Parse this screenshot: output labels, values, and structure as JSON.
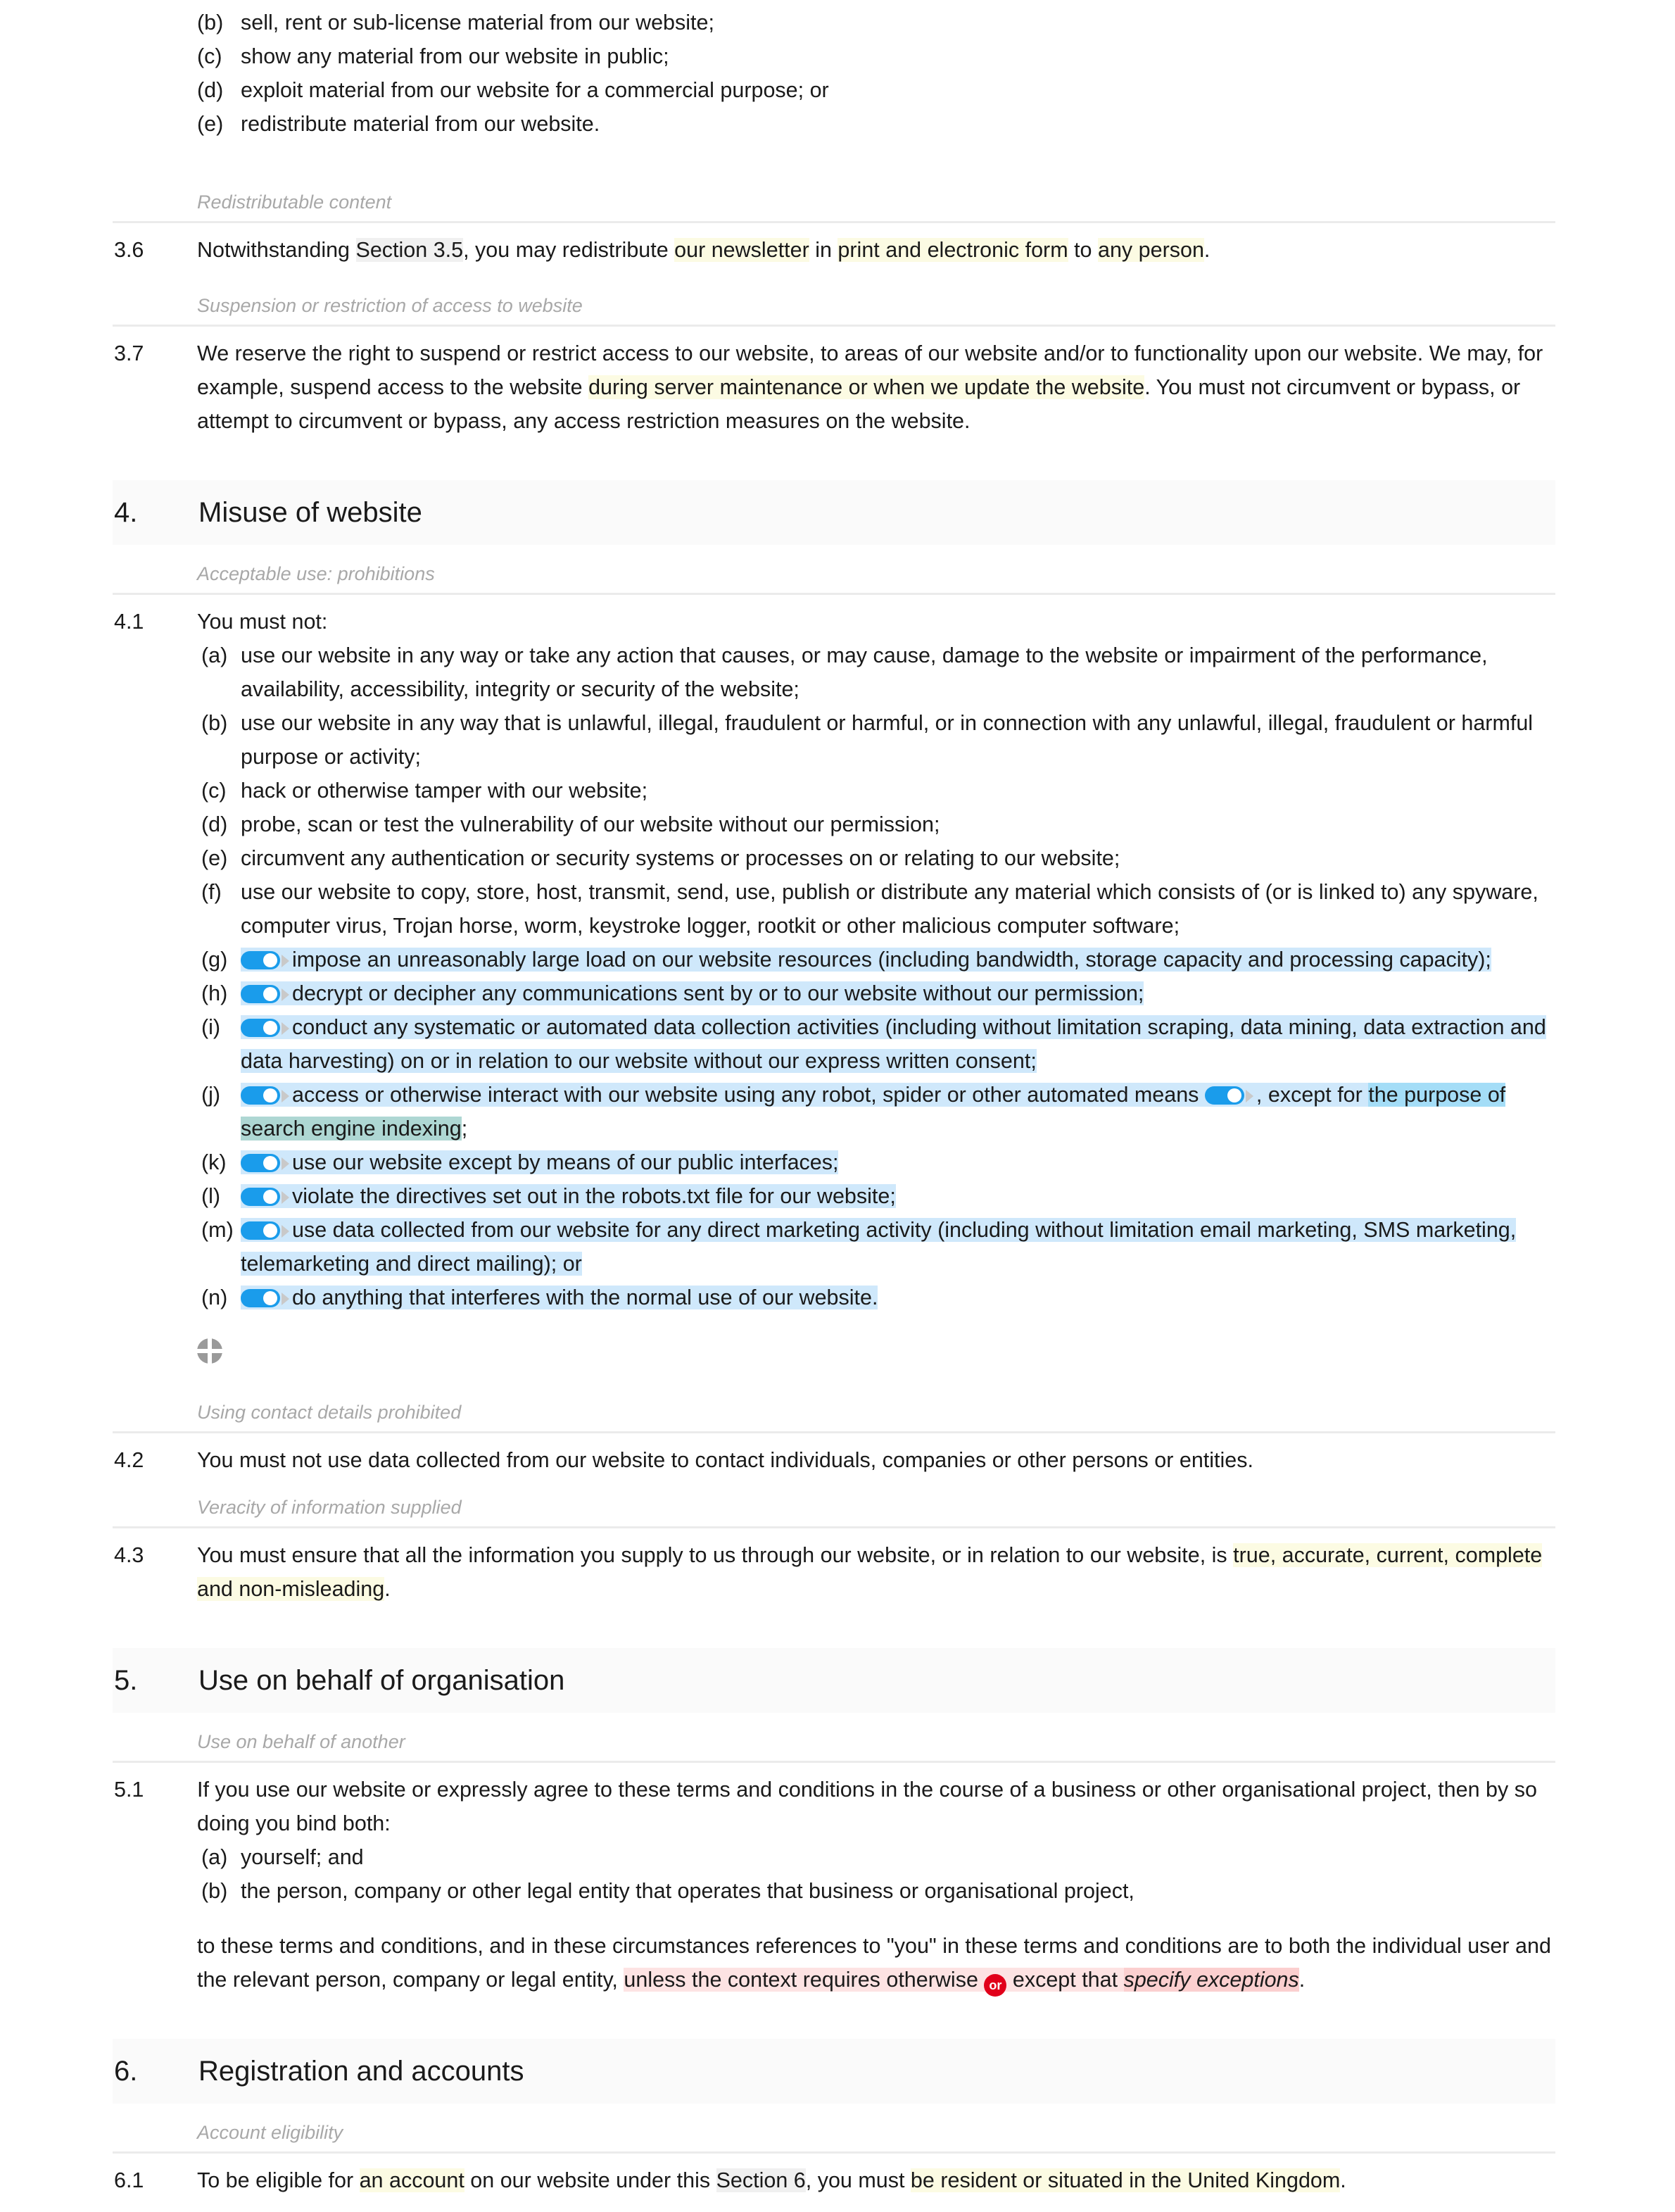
{
  "document": {
    "type": "terms-and-conditions",
    "colors": {
      "highlight_yellow": "#fcfbe3",
      "highlight_grey": "#f0f0f0",
      "highlight_blue": "#cfe8fb",
      "highlight_blue_strong": "#a4ddf7",
      "highlight_teal": "#aed7d3",
      "highlight_pink": "#fde3e3",
      "highlight_pink_strong": "#fbcfcf",
      "toggle_on": "#1a9ceb",
      "or_badge": "#e1001a",
      "section_band": "#fafafa",
      "subheading_grey": "#a8a8a8"
    }
  },
  "top_list": {
    "items": [
      {
        "label": "(b)",
        "text": "sell, rent or sub-license material from our website;"
      },
      {
        "label": "(c)",
        "text": "show any material from our website in public;"
      },
      {
        "label": "(d)",
        "text": "exploit material from our website for a commercial purpose; or"
      },
      {
        "label": "(e)",
        "text": "redistribute material from our website."
      }
    ]
  },
  "subheads": {
    "redistributable": "Redistributable content",
    "suspension": "Suspension or restriction of access to website",
    "acceptable_use": "Acceptable use: prohibitions",
    "contact_details": "Using contact details prohibited",
    "veracity": "Veracity of information supplied",
    "behalf_another": "Use on behalf of another",
    "account_eligibility": "Account eligibility"
  },
  "clause_3_6": {
    "number": "3.6",
    "parts": [
      {
        "text": "Notwithstanding ",
        "style": "plain"
      },
      {
        "text": "Section 3.5",
        "style": "grey"
      },
      {
        "text": ", you may redistribute ",
        "style": "plain"
      },
      {
        "text": "our newsletter",
        "style": "yellow"
      },
      {
        "text": " in ",
        "style": "plain"
      },
      {
        "text": "print and electronic form",
        "style": "yellow"
      },
      {
        "text": " to ",
        "style": "plain"
      },
      {
        "text": "any person",
        "style": "yellow"
      },
      {
        "text": ".",
        "style": "plain"
      }
    ]
  },
  "clause_3_7": {
    "number": "3.7",
    "parts": [
      {
        "text": "We reserve the right to suspend or restrict access to our website, to areas of our website and/or to functionality upon our website. We may, for example, suspend access to the website ",
        "style": "plain"
      },
      {
        "text": "during server maintenance or when we update the website",
        "style": "yellow"
      },
      {
        "text": ". You must not circumvent or bypass, or attempt to circumvent or bypass, any access restriction measures on the website.",
        "style": "plain"
      }
    ]
  },
  "section_4": {
    "number": "4.",
    "title": "Misuse of website"
  },
  "section_5": {
    "number": "5.",
    "title": "Use on behalf of organisation"
  },
  "section_6": {
    "number": "6.",
    "title": "Registration and accounts"
  },
  "clause_4_1": {
    "number": "4.1",
    "lead": "You must not:",
    "items": [
      {
        "label": "(a)",
        "toggle": false,
        "highlight": "none",
        "text": "use our website in any way or take any action that causes, or may cause, damage to the website or impairment of the performance, availability, accessibility, integrity or security of the website;"
      },
      {
        "label": "(b)",
        "toggle": false,
        "highlight": "none",
        "text": "use our website in any way that is unlawful, illegal, fraudulent or harmful, or in connection with any unlawful, illegal, fraudulent or harmful purpose or activity;"
      },
      {
        "label": "(c)",
        "toggle": false,
        "highlight": "none",
        "text": "hack or otherwise tamper with our website;"
      },
      {
        "label": "(d)",
        "toggle": false,
        "highlight": "none",
        "text": "probe, scan or test the vulnerability of our website without our permission;"
      },
      {
        "label": "(e)",
        "toggle": false,
        "highlight": "none",
        "text": "circumvent any authentication or security systems or processes on or relating to our website;"
      },
      {
        "label": "(f)",
        "toggle": false,
        "highlight": "none",
        "text": "use our website to copy, store, host, transmit, send, use, publish or distribute any material which consists of (or is linked to) any spyware, computer virus, Trojan horse, worm, keystroke logger, rootkit or other malicious computer software;"
      },
      {
        "label": "(g)",
        "toggle": true,
        "highlight": "blue",
        "text": "impose an unreasonably large load on our website resources (including bandwidth, storage capacity and processing capacity);"
      },
      {
        "label": "(h)",
        "toggle": true,
        "highlight": "blue",
        "text": "decrypt or decipher any communications sent by or to our website without our permission;"
      },
      {
        "label": "(i)",
        "toggle": true,
        "highlight": "blue",
        "text": "conduct any systematic or automated data collection activities (including without limitation scraping, data mining, data extraction and data harvesting) on or in relation to our website without our express written consent;"
      },
      {
        "label": "(j)",
        "toggle": true,
        "highlight": "blue",
        "special": "two-toggles",
        "text_before": "access or otherwise interact with our website using any robot, spider or other automated means",
        "text_mid": ", except for ",
        "text_strong": "the purpose of ",
        "text_teal": "search engine indexing",
        "text_after": ";"
      },
      {
        "label": "(k)",
        "toggle": true,
        "highlight": "blue",
        "text": "use our website except by means of our public interfaces;"
      },
      {
        "label": "(l)",
        "toggle": true,
        "highlight": "blue",
        "text": "violate the directives set out in the robots.txt file for our website;"
      },
      {
        "label": "(m)",
        "toggle": true,
        "highlight": "blue",
        "text": "use data collected from our website for any direct marketing activity (including without limitation email marketing, SMS marketing, telemarketing and direct mailing); or"
      },
      {
        "label": "(n)",
        "toggle": true,
        "highlight": "blue",
        "text": "do anything that interferes with the normal use of our website."
      }
    ]
  },
  "insert_icon": {
    "name": "insert-clause-icon"
  },
  "clause_4_2": {
    "number": "4.2",
    "text": "You must not use data collected from our website to contact individuals, companies or other persons or entities."
  },
  "clause_4_3": {
    "number": "4.3",
    "parts": [
      {
        "text": "You must ensure that all the information you supply to us through our website, or in relation to our website, is ",
        "style": "plain"
      },
      {
        "text": "true, accurate, current, complete and non-misleading",
        "style": "yellow"
      },
      {
        "text": ".",
        "style": "plain"
      }
    ]
  },
  "clause_5_1": {
    "number": "5.1",
    "lead": "If you use our website or expressly agree to these terms and conditions in the course of a business or other organisational project, then by so doing you bind both:",
    "items": [
      {
        "label": "(a)",
        "text": "yourself; and"
      },
      {
        "label": "(b)",
        "text": "the person, company or other legal entity that operates that business or organisational project,"
      }
    ],
    "tail_parts": [
      {
        "text": "to these terms and conditions, and in these circumstances references to \"you\" in these terms and conditions are to both the individual user and the relevant person, company or legal entity, ",
        "style": "plain"
      },
      {
        "text": "unless the context requires otherwise ",
        "style": "pink"
      },
      {
        "text": "or",
        "style": "badge"
      },
      {
        "text": " except that ",
        "style": "pink"
      },
      {
        "text": "specify exceptions",
        "style": "pink-strong-italic"
      },
      {
        "text": ".",
        "style": "plain"
      }
    ]
  },
  "clause_6_1": {
    "number": "6.1",
    "parts": [
      {
        "text": "To be eligible for ",
        "style": "plain"
      },
      {
        "text": "an account",
        "style": "yellow"
      },
      {
        "text": " on our website under this ",
        "style": "plain"
      },
      {
        "text": "Section 6",
        "style": "grey"
      },
      {
        "text": ", you must ",
        "style": "plain"
      },
      {
        "text": "be resident or situated in the United Kingdom",
        "style": "yellow"
      },
      {
        "text": ".",
        "style": "plain"
      }
    ]
  }
}
